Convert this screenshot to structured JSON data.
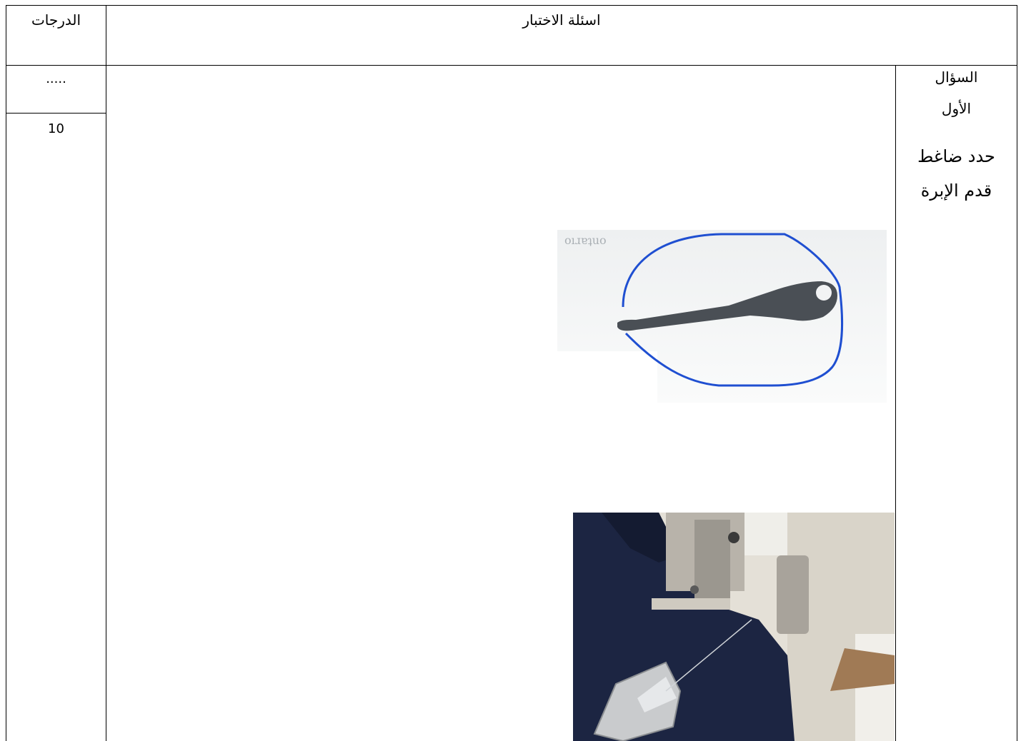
{
  "header": {
    "grades_label": "الدرجات",
    "questions_label": "اسئلة  الاختبار"
  },
  "grades_column": {
    "placeholder": ".....",
    "score": "10"
  },
  "question": {
    "number_label_line1": "السؤال",
    "number_label_line2": "الأول",
    "prompt_line1": "حدد ضاغط",
    "prompt_line2": "قدم الإبرة"
  },
  "images": {
    "looper_part": {
      "icon": "presser-foot-part-image",
      "highlight_color": "#1f4fd1",
      "part_color": "#4a4f55"
    },
    "serger_machine": {
      "icon": "serger-machine-photo",
      "fabric_color": "#1c2542",
      "machine_color": "#d9d4c9"
    }
  }
}
